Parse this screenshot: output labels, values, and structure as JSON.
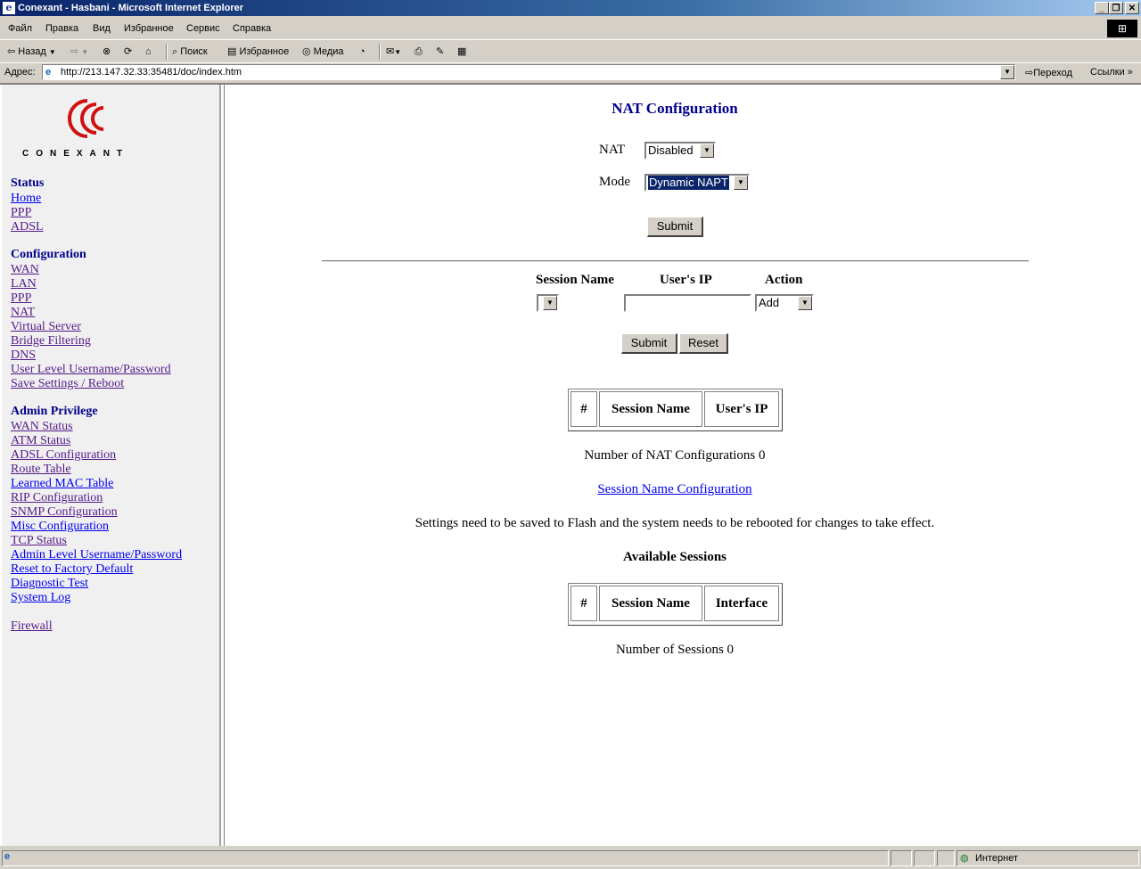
{
  "window": {
    "title": "Conexant - Hasbani - Microsoft Internet Explorer"
  },
  "menu": [
    "Файл",
    "Правка",
    "Вид",
    "Избранное",
    "Сервис",
    "Справка"
  ],
  "toolbar": {
    "back": "Назад",
    "search": "Поиск",
    "favorites": "Избранное",
    "media": "Медиа"
  },
  "address": {
    "label": "Адрес:",
    "url": "http://213.147.32.33:35481/doc/index.htm",
    "go": "Переход",
    "links": "Ссылки"
  },
  "logo": {
    "text": "CONEXANT"
  },
  "nav": {
    "status_heading": "Status",
    "status_links": [
      "Home",
      "PPP",
      "ADSL"
    ],
    "config_heading": "Configuration",
    "config_links": [
      "WAN",
      "LAN",
      "PPP",
      "NAT",
      "Virtual Server",
      "Bridge Filtering",
      "DNS",
      "User Level Username/Password",
      "Save Settings / Reboot"
    ],
    "admin_heading": "Admin Privilege",
    "admin_links": [
      "WAN Status",
      "ATM Status",
      "ADSL Configuration",
      "Route Table",
      "Learned MAC Table",
      "RIP Configuration",
      "SNMP Configuration",
      "Misc Configuration",
      "TCP Status",
      "Admin Level Username/Password",
      "Reset to Factory Default",
      "Diagnostic Test",
      "System Log"
    ],
    "firewall": "Firewall"
  },
  "page": {
    "title": "NAT Configuration",
    "nat_label": "NAT",
    "nat_value": "Disabled",
    "mode_label": "Mode",
    "mode_value": "Dynamic NAPT",
    "submit": "Submit",
    "session_header": "Session Name",
    "ip_header": "User's IP",
    "action_header": "Action",
    "session_value": "",
    "ip_value": "",
    "action_value": "Add",
    "submit2": "Submit",
    "reset": "Reset",
    "table1": [
      "#",
      "Session Name",
      "User's IP"
    ],
    "count_text": "Number of NAT Configurations 0",
    "session_config_link": "Session Name Configuration",
    "note": "Settings need to be saved to Flash and the system needs to be rebooted for changes to take effect.",
    "available_title": "Available Sessions",
    "table2": [
      "#",
      "Session Name",
      "Interface"
    ],
    "sessions_count": "Number of Sessions 0"
  },
  "statusbar": {
    "zone": "Интернет"
  }
}
